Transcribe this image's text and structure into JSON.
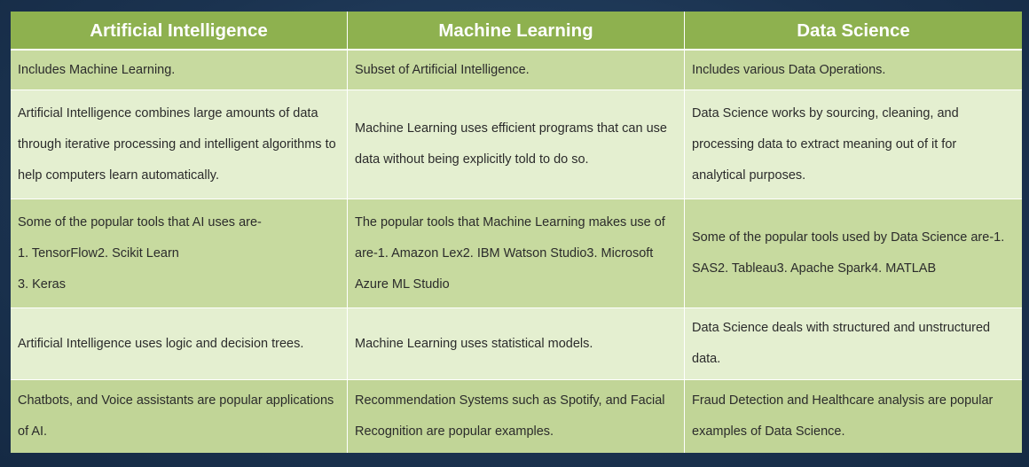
{
  "table": {
    "headers": [
      "Artificial Intelligence",
      "Machine Learning",
      "Data Science"
    ],
    "rows": [
      {
        "ai": [
          "Includes Machine Learning."
        ],
        "ml": [
          "Subset of Artificial Intelligence."
        ],
        "ds": [
          "Includes various Data Operations."
        ]
      },
      {
        "ai": [
          "Artificial Intelligence combines large amounts of data",
          "through iterative processing and intelligent algorithms to",
          "help computers learn automatically."
        ],
        "ml": [
          "Machine Learning uses efficient programs that can use",
          "data without being explicitly told to do so."
        ],
        "ds": [
          "Data Science works by sourcing, cleaning, and",
          "processing data to extract meaning out of it for",
          "analytical purposes."
        ]
      },
      {
        "ai": [
          "Some of the popular tools that AI uses are-",
          "1. TensorFlow2. Scikit Learn",
          "3. Keras"
        ],
        "ml": [
          "The popular tools that Machine Learning makes use of",
          "are-1. Amazon Lex2. IBM Watson Studio3. Microsoft",
          "Azure ML Studio"
        ],
        "ds": [
          "Some of the popular tools used by Data Science are-1.",
          "SAS2. Tableau3. Apache Spark4. MATLAB"
        ]
      },
      {
        "ai": [
          "Artificial Intelligence uses logic and decision trees."
        ],
        "ml": [
          "Machine Learning uses statistical models."
        ],
        "ds": [
          "Data Science deals with structured and unstructured",
          "data."
        ]
      },
      {
        "ai": [
          "Chatbots, and Voice assistants are popular applications",
          "of AI."
        ],
        "ml": [
          "Recommendation Systems such as Spotify, and Facial",
          "Recognition are popular examples."
        ],
        "ds": [
          "Fraud Detection and Healthcare analysis are popular",
          "examples of Data Science."
        ]
      }
    ]
  }
}
